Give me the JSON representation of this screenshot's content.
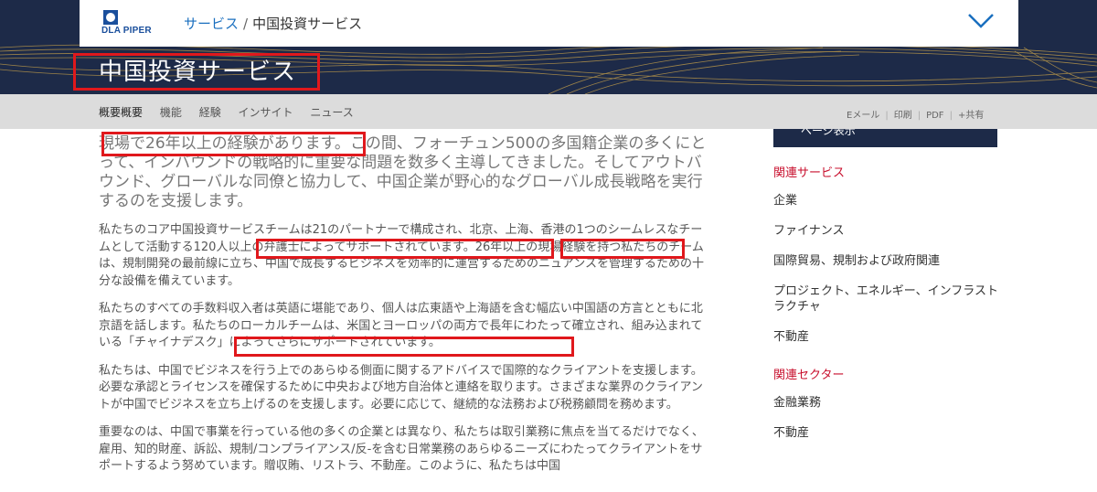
{
  "header": {
    "logo_text": "DLA PIPER",
    "breadcrumb": [
      {
        "label": "サービス"
      },
      {
        "label": "中国投資サービス"
      }
    ],
    "breadcrumb_sep": "/",
    "page_title": "中国投資サービス"
  },
  "subnav": {
    "tabs": [
      "概要概要",
      "機能",
      "経験",
      "インサイト",
      "ニュース"
    ],
    "actions": [
      "Eメール",
      "印刷",
      "PDF",
      "+共有"
    ]
  },
  "sidebar_button": "ページ表示",
  "main": {
    "lead_parts": [
      "現場で26年以上の経験があります。",
      "この間、フォーチュン500の多国籍企業の多くにとって、インバウンドの戦略的に重要な問題を数多く主導してきました。そしてアウトバウンド、グローバルな同僚と協力して、中国企業が野心的なグローバル成長戦略を実行するのを支援します。"
    ],
    "p1_parts": [
      "私たちのコア中国投資サービスチームは21のパートナーで構成され、北京、上海、香港の1つのシームレスなチームとして活動する",
      "120人以上の弁護士によってサポートされています",
      "。",
      "26年以上の現場経験",
      "を持つ私たちのチームは、規制開発の最前線に立ち、中国で成長するビジネスを効率的に運営するためのニュアンスを管理するための十分な設備を備えています。"
    ],
    "p2_parts": [
      "私たちのすべての手数料収入者は英語に堪能であり、個人は広東語や上海語を含む幅広い中国語の方言とともに北京語を話します。私たちのローカルチームは、米国とヨーロッパの両方で長年にわたって確立され、組み込まれている",
      "「チャイナデスク」によってさらにサポートされています。"
    ],
    "p3": "私たちは、中国でビジネスを行う上でのあらゆる側面に関するアドバイスで国際的なクライアントを支援します。必要な承認とライセンスを確保するために中央および地方自治体と連絡を取ります。さまざまな業界のクライアントが中国でビジネスを立ち上げるのを支援します。必要に応じて、継続的な法務および税務顧問を務めます。",
    "p4": "重要なのは、中国で事業を行っている他の多くの企業とは異なり、私たちは取引業務に焦点を当てるだけでなく、雇用、知的財産、訴訟、規制/コンプライアンス/反-を含む日常業務のあらゆるニーズにわたってクライアントをサポートするよう努めています。贈収賄、リストラ、不動産。このように、私たちは中国"
  },
  "sidebar": {
    "related_services_heading": "関連サービス",
    "related_services": [
      "企業",
      "ファイナンス",
      "国際貿易、規制および政府関連",
      "プロジェクト、エネルギー、インフラストラクチャ",
      "不動産"
    ],
    "related_sectors_heading": "関連セクター",
    "related_sectors": [
      "金融業務",
      "不動産"
    ]
  },
  "colors": {
    "navy": "#1d2a48",
    "link_blue": "#1a6fbf",
    "accent_red": "#c8102e",
    "annotation_red": "#e0181c"
  }
}
